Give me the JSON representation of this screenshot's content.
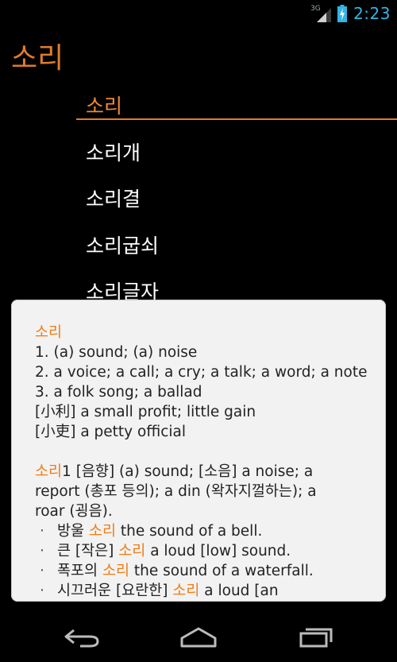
{
  "status_bar": {
    "network": "3G",
    "time": "2:23"
  },
  "app": {
    "title": "소리"
  },
  "word_list": [
    {
      "label": "소리",
      "selected": true
    },
    {
      "label": "소리개",
      "selected": false
    },
    {
      "label": "소리결",
      "selected": false
    },
    {
      "label": "소리굽쇠",
      "selected": false
    },
    {
      "label": "소리글자",
      "selected": false
    }
  ],
  "definition_popup": {
    "entry1": {
      "headword": "소리",
      "senses": [
        "1. (a) sound; (a) noise",
        "2. a voice; a call; a cry; a talk; a word; a note",
        "3. a folk song; a ballad",
        "[小利] a small profit; little gain",
        "[小吏] a petty official"
      ]
    },
    "entry2": {
      "headword": "소리",
      "line1_rest": "1 [음향] (a) sound; [소음] a noise; a",
      "line2": "report (총포 등의); a din (왁자지껄하는); a",
      "line3": "roar (굉음).",
      "examples": [
        {
          "before": "방울 ",
          "highlight": "소리",
          "after": " the sound of a bell."
        },
        {
          "before": "큰 [작은] ",
          "highlight": "소리",
          "after": " a loud [low] sound."
        },
        {
          "before": "폭포의 ",
          "highlight": "소리",
          "after": " the sound of a waterfall."
        },
        {
          "before": "시끄러운 [요란한] ",
          "highlight": "소리",
          "after": " a loud [an"
        }
      ]
    }
  },
  "nav_bar": {
    "icons": [
      "back-icon",
      "home-icon",
      "recent-apps-icon"
    ]
  },
  "colors": {
    "accent": "#e07c2b",
    "highlight": "#f07b14",
    "clock": "#33b5e5"
  }
}
